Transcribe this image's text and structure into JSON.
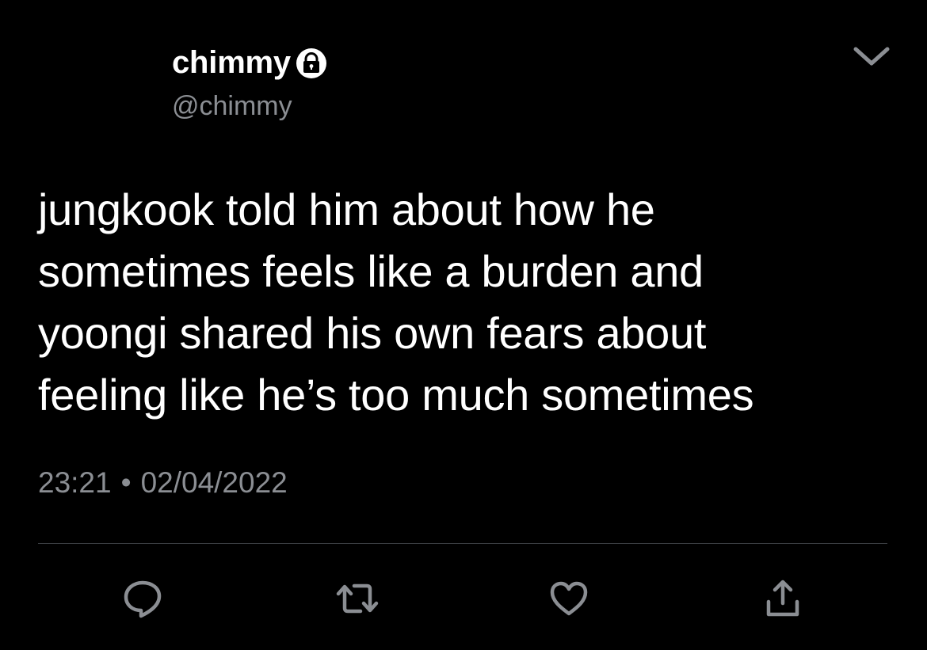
{
  "user": {
    "display_name": "chimmy",
    "handle": "@chimmy",
    "protected_icon": "lock-icon"
  },
  "tweet": {
    "text": "jungkook told him about how he\nsometimes feels like a burden and\nyoongi shared his own fears about\nfeeling like he’s too much sometimes",
    "time": "23:21",
    "separator": "•",
    "date": "02/04/2022"
  },
  "actions": [
    {
      "icon": "reply-icon"
    },
    {
      "icon": "retweet-icon"
    },
    {
      "icon": "like-icon"
    },
    {
      "icon": "share-icon"
    }
  ],
  "menu_icon": "chevron-down-icon",
  "colors": {
    "background": "#000000",
    "text": "#ffffff",
    "secondary": "#8b8e93",
    "divider": "#3a3d41"
  }
}
